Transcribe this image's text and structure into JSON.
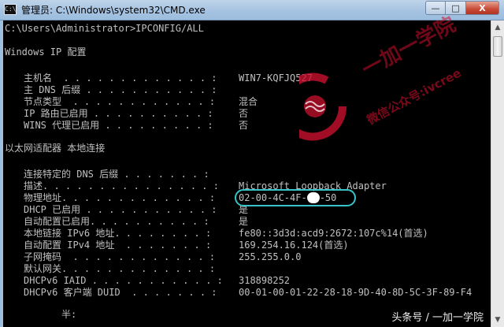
{
  "window": {
    "title": "管理员: C:\\Windows\\system32\\CMD.exe",
    "min_glyph": "—",
    "max_glyph": "□",
    "close_glyph": "X"
  },
  "scrollbar": {
    "up_glyph": "▲",
    "down_glyph": "▼"
  },
  "console": {
    "command_line": "C:\\Users\\Administrator>IPCONFIG/ALL",
    "section_windows_ip": "Windows IP 配置",
    "windows_ip_entries": [
      {
        "label": "主机名  . . . . . . . . . . . . . :",
        "value": "WIN7-KQFJQ527"
      },
      {
        "label": "主 DNS 后缀 . . . . . . . . . . . :",
        "value": ""
      },
      {
        "label": "节点类型  . . . . . . . . . . . . :",
        "value": "混合"
      },
      {
        "label": "IP 路由已启用 . . . . . . . . . . :",
        "value": "否"
      },
      {
        "label": "WINS 代理已启用 . . . . . . . . . :",
        "value": "否"
      }
    ],
    "section_adapter": "以太网适配器 本地连接",
    "adapter_entries": [
      {
        "label": "连接特定的 DNS 后缀 . . . . . . . :",
        "value": ""
      },
      {
        "label": "描述. . . . . . . . . . . . . . . :",
        "value": "Microsoft Loopback Adapter"
      },
      {
        "label": "物理地址. . . . . . . . . . . . . :",
        "value": ""
      },
      {
        "label": "DHCP 已启用 . . . . . . . . . . . :",
        "value": "是"
      },
      {
        "label": "自动配置已启用. . . . . . . . . . :",
        "value": "是"
      },
      {
        "label": "本地链接 IPv6 地址. . . . . . . . :",
        "value": "fe80::3d3d:acd9:2672:107c%14(首选)"
      },
      {
        "label": "自动配置 IPv4 地址  . . . . . . . :",
        "value": "169.254.16.124(首选)"
      },
      {
        "label": "子网掩码  . . . . . . . . . . . . :",
        "value": "255.255.0.0"
      },
      {
        "label": "默认网关. . . . . . . . . . . . . :",
        "value": ""
      },
      {
        "label": "DHCPv6 IAID . . . . . . . . . . . :",
        "value": "318898252"
      },
      {
        "label": "DHCPv6 客户端 DUID  . . . . . . . :",
        "value": "00-01-00-01-22-28-18-9D-40-8D-5C-3F-89-F4"
      }
    ],
    "mac_address_prefix": "02-00-4C-4F-",
    "mac_address_suffix": "-50",
    "last_line_partial": "半:"
  },
  "watermark": {
    "brand_text": "一加一学院",
    "wechat_text": "微信公众号:ivcree",
    "footer_text": "头条号 / 一加一学院"
  },
  "colors": {
    "console_bg": "#000000",
    "console_text": "#c0c0c0",
    "highlight_ring": "#36c3c9",
    "watermark_red": "#c8102e"
  }
}
